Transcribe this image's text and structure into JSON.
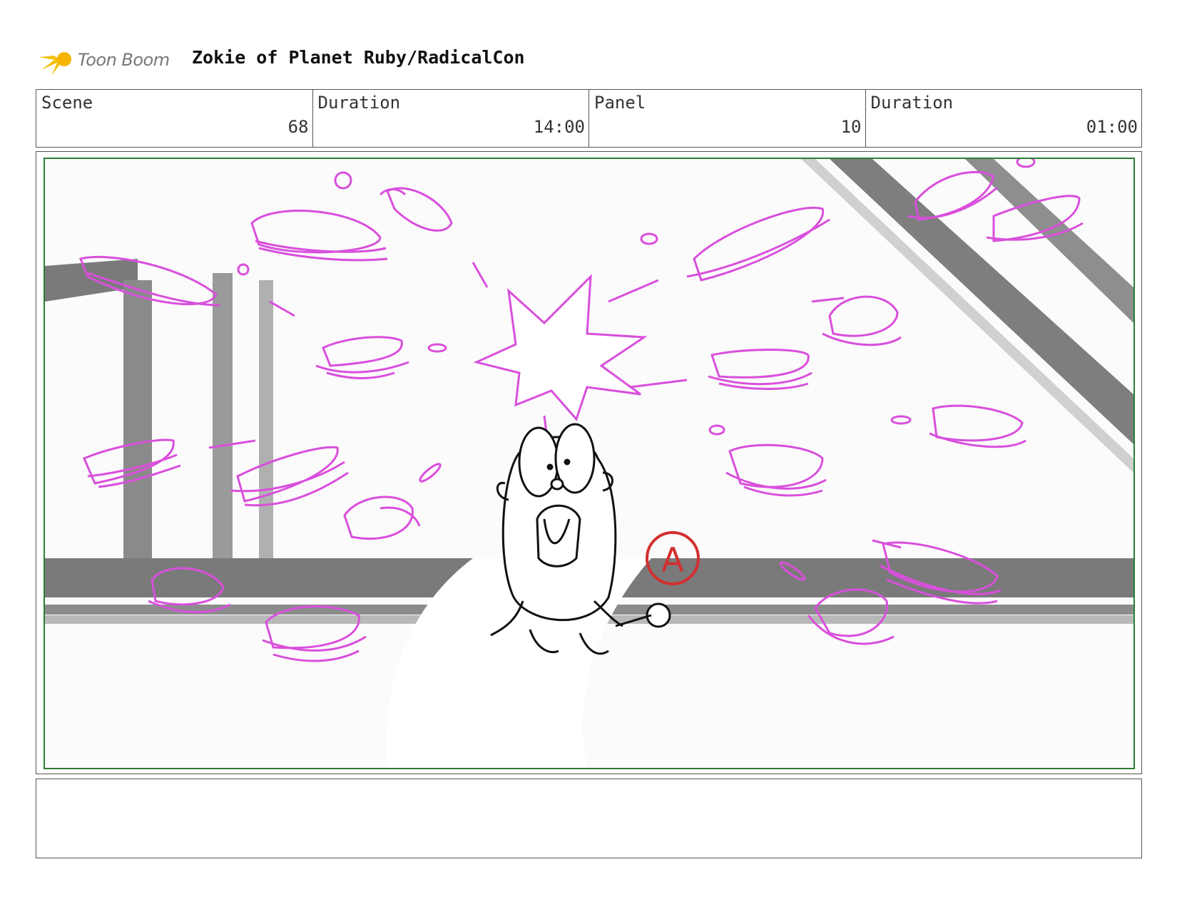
{
  "header": {
    "logo_text": "Toon Boom",
    "title": "Zokie of Planet Ruby/RadicalCon"
  },
  "info": {
    "scene_label": "Scene",
    "scene_value": "68",
    "scene_duration_label": "Duration",
    "scene_duration_value": "14:00",
    "panel_label": "Panel",
    "panel_value": "10",
    "panel_duration_label": "Duration",
    "panel_duration_value": "01:00"
  },
  "panel": {
    "annotation_letter": "A"
  },
  "colors": {
    "sketch_magenta": "#d94fdc",
    "annotation_red": "#d32f2f",
    "frame_green": "#2e7d32",
    "logo_yellow": "#f4c20d"
  }
}
